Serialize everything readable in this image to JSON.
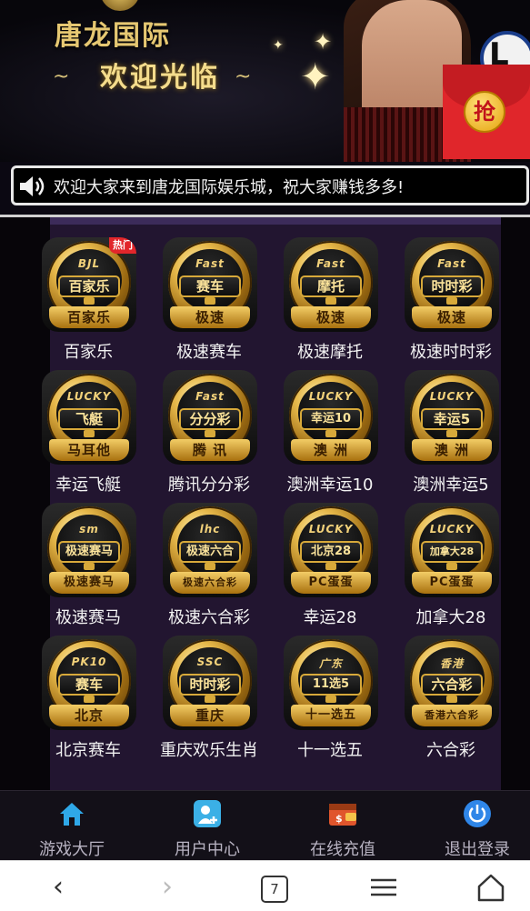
{
  "header": {
    "brand_name": "唐龙国际",
    "welcome": "欢迎光临",
    "grab_label": "抢",
    "chip_letter": "L"
  },
  "notice": {
    "text": "欢迎大家来到唐龙国际娱乐城，祝大家赚钱多多!"
  },
  "games": [
    {
      "label": "百家乐",
      "eyebrow": "BJL",
      "plate": "百家乐",
      "sub": "百家乐",
      "tag": "热门"
    },
    {
      "label": "极速赛车",
      "eyebrow": "Fast",
      "plate": "赛车",
      "sub": "极速"
    },
    {
      "label": "极速摩托",
      "eyebrow": "Fast",
      "plate": "摩托",
      "sub": "极速"
    },
    {
      "label": "极速时时彩",
      "eyebrow": "Fast",
      "plate": "时时彩",
      "sub": "极速"
    },
    {
      "label": "幸运飞艇",
      "eyebrow": "LUCKY",
      "plate": "飞艇",
      "sub": "马耳他"
    },
    {
      "label": "腾讯分分彩",
      "eyebrow": "Fast",
      "plate": "分分彩",
      "sub": "腾 讯"
    },
    {
      "label": "澳洲幸运10",
      "eyebrow": "LUCKY",
      "plate": "幸运10",
      "sub": "澳 洲"
    },
    {
      "label": "澳洲幸运5",
      "eyebrow": "LUCKY",
      "plate": "幸运5",
      "sub": "澳 洲"
    },
    {
      "label": "极速赛马",
      "eyebrow": "sm",
      "plate": "极速赛马",
      "sub": "极速赛马"
    },
    {
      "label": "极速六合彩",
      "eyebrow": "lhc",
      "plate": "极速六合",
      "sub": "极速六合彩"
    },
    {
      "label": "幸运28",
      "eyebrow": "LUCKY",
      "plate": "北京28",
      "sub": "PC蛋蛋"
    },
    {
      "label": "加拿大28",
      "eyebrow": "LUCKY",
      "plate": "加拿大28",
      "sub": "PC蛋蛋"
    },
    {
      "label": "北京赛车",
      "eyebrow": "PK10",
      "plate": "赛车",
      "sub": "北京"
    },
    {
      "label": "重庆欢乐生肖",
      "eyebrow": "SSC",
      "plate": "时时彩",
      "sub": "重庆"
    },
    {
      "label": "十一选五",
      "eyebrow": "广东",
      "plate": "11选5",
      "sub": "十一选五"
    },
    {
      "label": "六合彩",
      "eyebrow": "香港",
      "plate": "六合彩",
      "sub": "香港六合彩"
    }
  ],
  "nav": [
    {
      "label": "游戏大厅",
      "icon": "home-icon",
      "color": "#2fa8e8"
    },
    {
      "label": "用户中心",
      "icon": "user-add-icon",
      "color": "#3bb0e6"
    },
    {
      "label": "在线充值",
      "icon": "wallet-icon",
      "color": "#e0552c"
    },
    {
      "label": "退出登录",
      "icon": "power-icon",
      "color": "#2f86e8"
    }
  ],
  "browser": {
    "tab_count": "7"
  },
  "colors": {
    "gold": "#e6b84a",
    "panel": "#221530",
    "banner": "#07060b"
  }
}
